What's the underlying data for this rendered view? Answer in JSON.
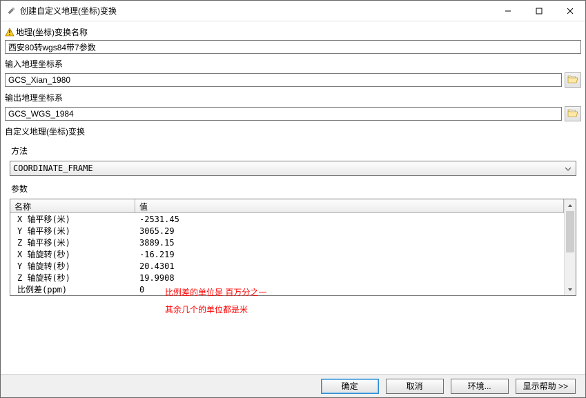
{
  "window": {
    "title": "创建自定义地理(坐标)变换"
  },
  "fields": {
    "name_label": "地理(坐标)变换名称",
    "name_value": "西安80转wgs84带7参数",
    "input_cs_label": "输入地理坐标系",
    "input_cs_value": "GCS_Xian_1980",
    "output_cs_label": "输出地理坐标系",
    "output_cs_value": "GCS_WGS_1984",
    "custom_label": "自定义地理(坐标)变换",
    "method_label": "方法",
    "method_value": "COORDINATE_FRAME",
    "params_label": "参数"
  },
  "param_table": {
    "header_name": "名称",
    "header_value": "值",
    "rows": [
      {
        "name": "X 轴平移(米)",
        "value": "-2531.45"
      },
      {
        "name": "Y 轴平移(米)",
        "value": "3065.29"
      },
      {
        "name": "Z 轴平移(米)",
        "value": "3889.15"
      },
      {
        "name": "X 轴旋转(秒)",
        "value": "-16.219"
      },
      {
        "name": "Y 轴旋转(秒)",
        "value": "20.4301"
      },
      {
        "name": "Z 轴旋转(秒)",
        "value": "19.9908"
      },
      {
        "name": "比例差(ppm)",
        "value": "0"
      }
    ]
  },
  "notes": {
    "line1": "比例差的单位是 百万分之一",
    "line2": "其余几个的单位都是米"
  },
  "buttons": {
    "ok": "确定",
    "cancel": "取消",
    "env": "环境...",
    "help": "显示帮助 >>"
  }
}
